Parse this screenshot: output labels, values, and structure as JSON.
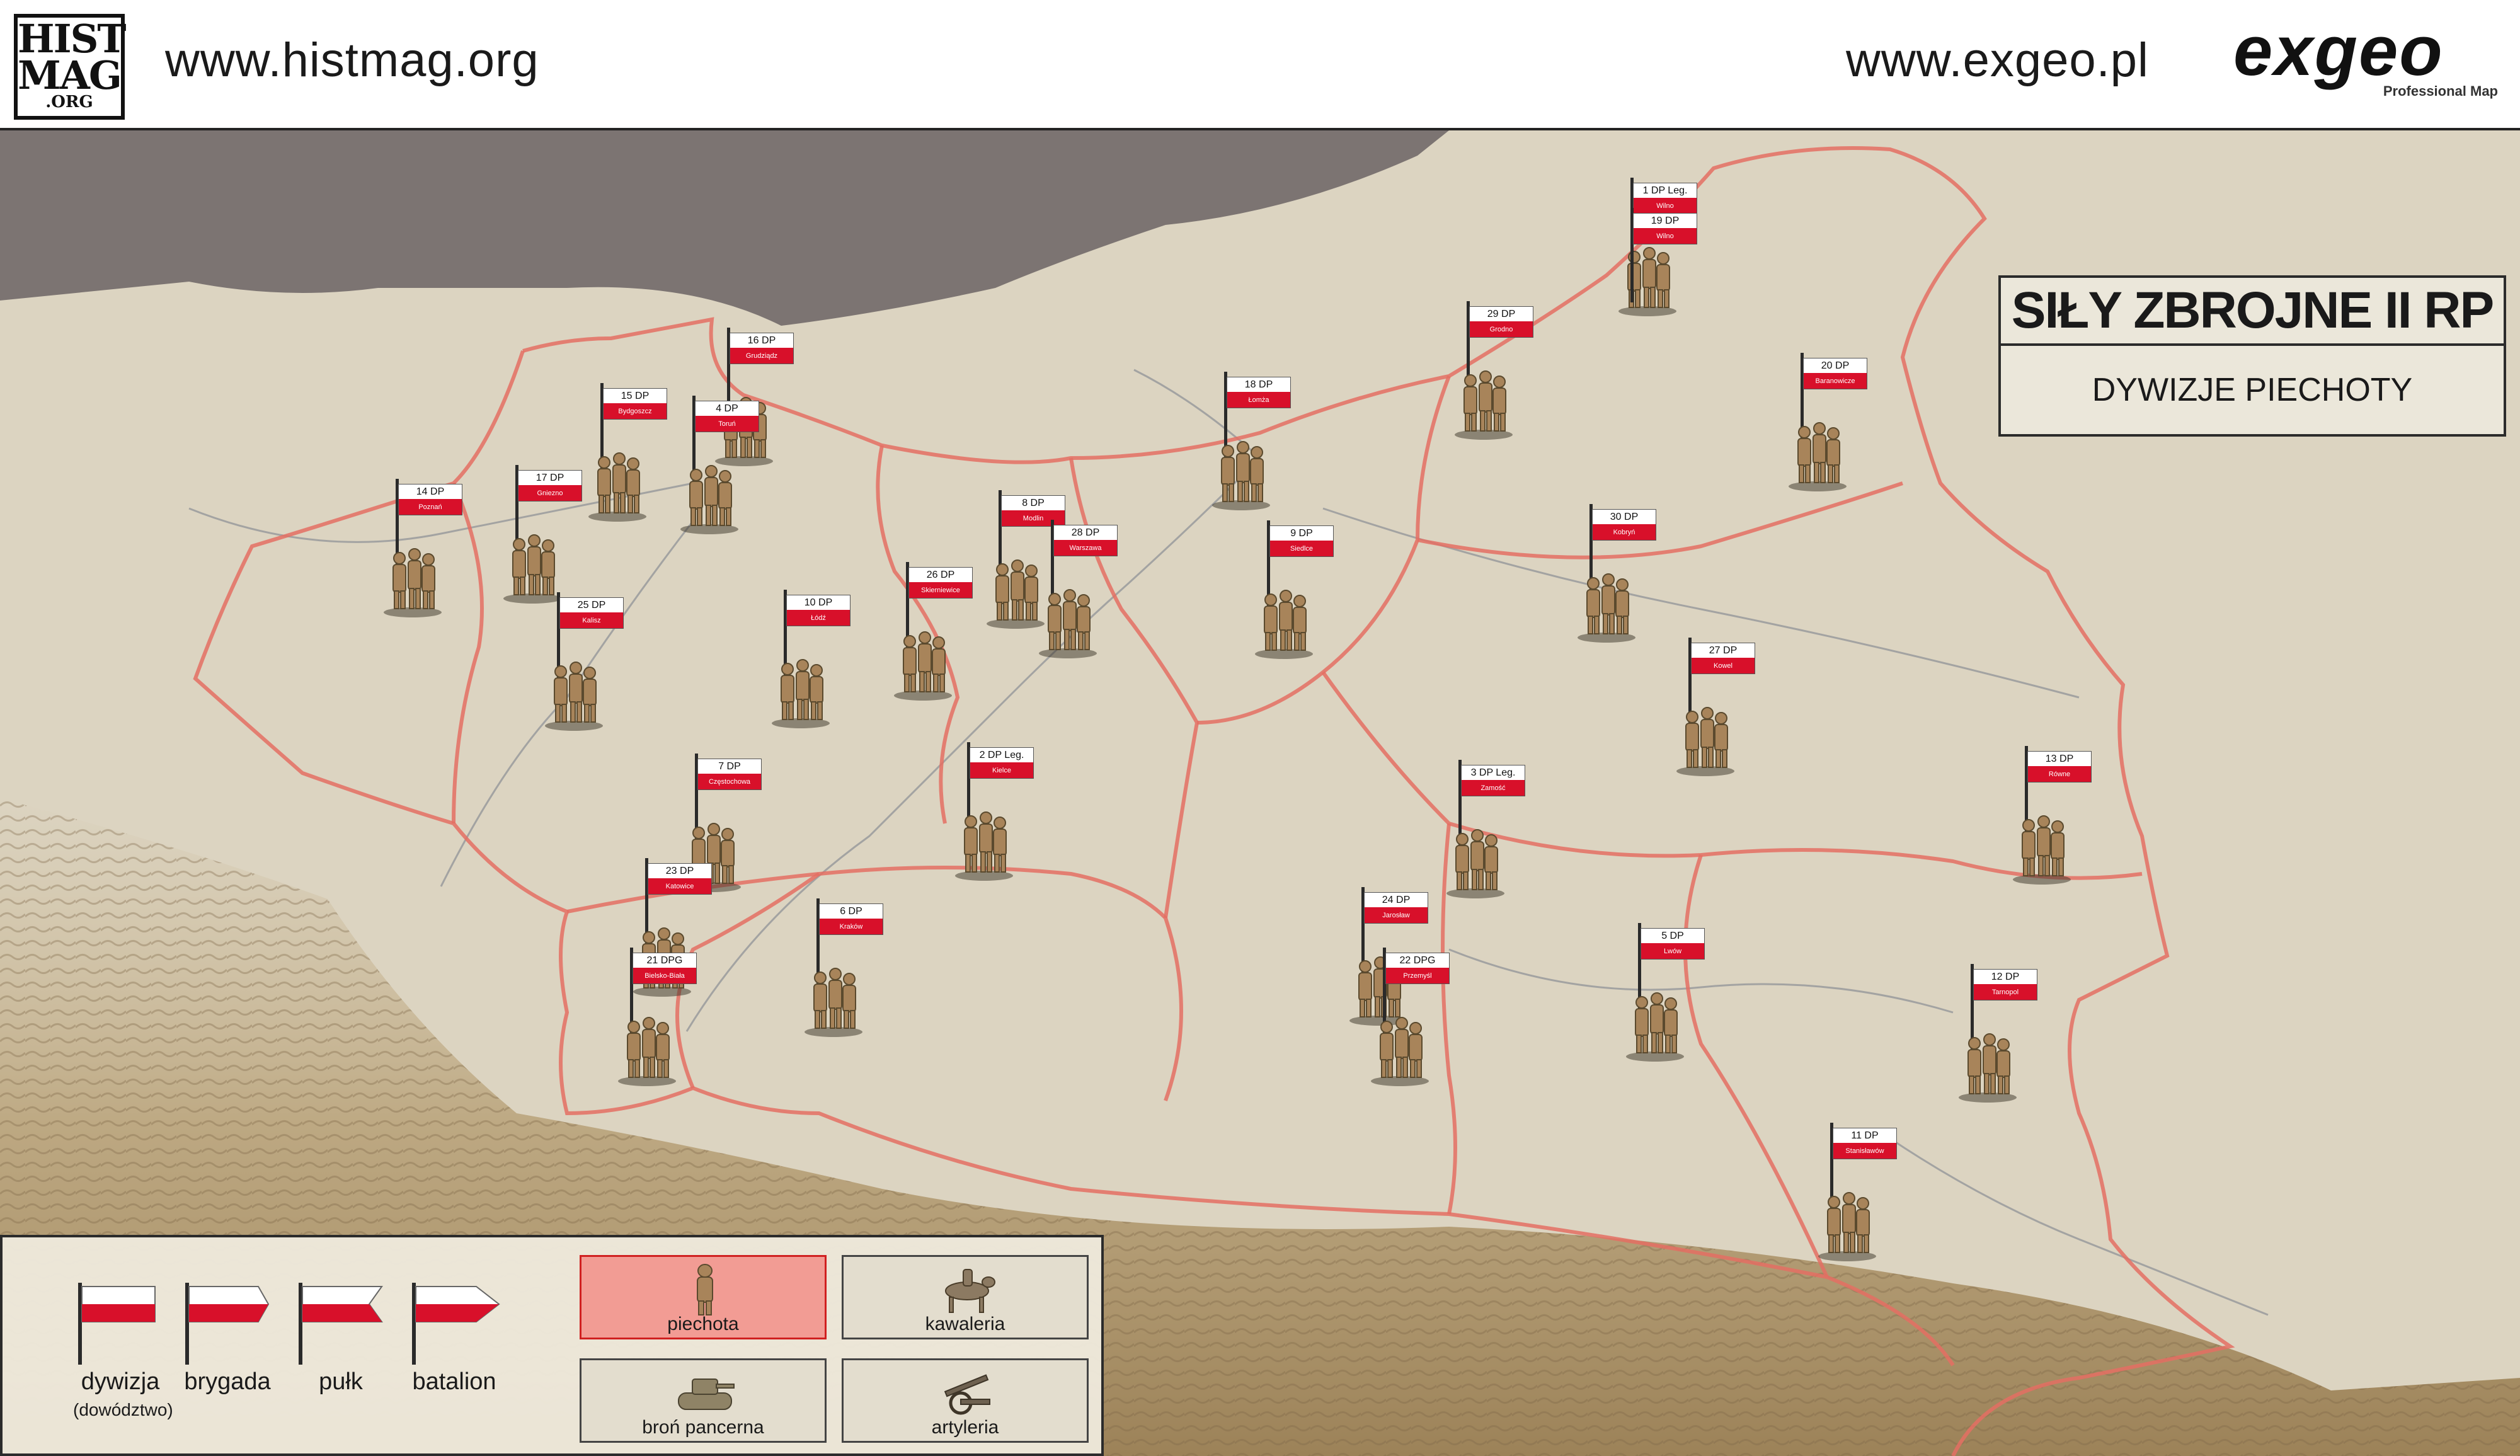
{
  "header": {
    "histmag_logo": {
      "line1": "HIST",
      "line2": "MAG",
      "line3": ".ORG"
    },
    "histmag_url": "www.histmag.org",
    "exgeo_url": "www.exgeo.pl",
    "exgeo_logo": {
      "word": "exgeo",
      "tagline": "Professional Map"
    }
  },
  "title_box": {
    "title": "SIŁY ZBROJNE II RP",
    "subtitle": "DYWIZJE PIECHOTY"
  },
  "units": [
    {
      "name": "1 DP Leg.",
      "city": "Wilno"
    },
    {
      "name": "19 DP",
      "city": "Wilno"
    },
    {
      "name": "29 DP",
      "city": "Grodno"
    },
    {
      "name": "20 DP",
      "city": "Baranowicze"
    },
    {
      "name": "18 DP",
      "city": "Łomża"
    },
    {
      "name": "16 DP",
      "city": "Grudziądz"
    },
    {
      "name": "15 DP",
      "city": "Bydgoszcz"
    },
    {
      "name": "4 DP",
      "city": "Toruń"
    },
    {
      "name": "17 DP",
      "city": "Gniezno"
    },
    {
      "name": "14 DP",
      "city": "Poznań"
    },
    {
      "name": "8 DP",
      "city": "Modlin"
    },
    {
      "name": "28 DP",
      "city": "Warszawa"
    },
    {
      "name": "9 DP",
      "city": "Siedlce"
    },
    {
      "name": "30 DP",
      "city": "Kobryń"
    },
    {
      "name": "26 DP",
      "city": "Skierniewice"
    },
    {
      "name": "10 DP",
      "city": "Łódź"
    },
    {
      "name": "25 DP",
      "city": "Kalisz"
    },
    {
      "name": "27 DP",
      "city": "Kowel"
    },
    {
      "name": "7 DP",
      "city": "Częstochowa"
    },
    {
      "name": "2 DP Leg.",
      "city": "Kielce"
    },
    {
      "name": "3 DP Leg.",
      "city": "Zamość"
    },
    {
      "name": "13 DP",
      "city": "Równe"
    },
    {
      "name": "23 DP",
      "city": "Katowice"
    },
    {
      "name": "6 DP",
      "city": "Kraków"
    },
    {
      "name": "21 DPG",
      "city": "Bielsko-Biała"
    },
    {
      "name": "24 DP",
      "city": "Jarosław"
    },
    {
      "name": "22 DPG",
      "city": "Przemyśl"
    },
    {
      "name": "5 DP",
      "city": "Lwów"
    },
    {
      "name": "12 DP",
      "city": "Tarnopol"
    },
    {
      "name": "11 DP",
      "city": "Stanisławów"
    }
  ],
  "legend": {
    "flags": [
      {
        "label": "dywizja",
        "sub": "(dowództwo)",
        "shape": "rectangle"
      },
      {
        "label": "brygada",
        "sub": "",
        "shape": "notched"
      },
      {
        "label": "pułk",
        "sub": "",
        "shape": "swallowtail"
      },
      {
        "label": "batalion",
        "sub": "",
        "shape": "pennant"
      }
    ],
    "unit_types": [
      {
        "label": "piechota",
        "icon": "infantry-icon",
        "active": true
      },
      {
        "label": "kawaleria",
        "icon": "cavalry-icon",
        "active": false
      },
      {
        "label": "broń pancerna",
        "icon": "tank-icon",
        "active": false
      },
      {
        "label": "artyleria",
        "icon": "artillery-icon",
        "active": false
      }
    ]
  },
  "colors": {
    "flag_red": "#d8102a",
    "border_red": "#e0504a",
    "sea": "#7c7472",
    "land": "#ddd5c2",
    "active_legend": "#f29c94"
  }
}
